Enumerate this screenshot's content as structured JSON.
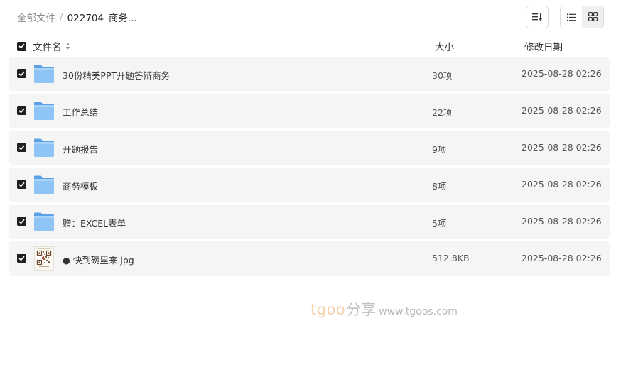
{
  "breadcrumb": {
    "root": "全部文件",
    "separator": "/",
    "current": "022704_商务..."
  },
  "header": {
    "name": "文件名",
    "size": "大小",
    "date": "修改日期"
  },
  "toolbar": {
    "sort_icon": "sort-icon",
    "list_view_icon": "list-view-icon",
    "grid_view_icon": "grid-view-icon",
    "active_view": "grid"
  },
  "files": [
    {
      "name": "30份精美PPT开题答辩商务",
      "size": "30项",
      "date": "2025-08-28 02:26",
      "type": "folder",
      "checked": true
    },
    {
      "name": "工作总结",
      "size": "22项",
      "date": "2025-08-28 02:26",
      "type": "folder",
      "checked": true
    },
    {
      "name": "开题报告",
      "size": "9项",
      "date": "2025-08-28 02:26",
      "type": "folder",
      "checked": true
    },
    {
      "name": "商务模板",
      "size": "8项",
      "date": "2025-08-28 02:26",
      "type": "folder",
      "checked": true
    },
    {
      "name": "赠：EXCEL表单",
      "size": "5项",
      "date": "2025-08-28 02:26",
      "type": "folder",
      "checked": true
    },
    {
      "name": "● 快到碗里来.jpg",
      "size": "512.8KB",
      "date": "2025-08-28 02:26",
      "type": "image",
      "checked": true
    }
  ],
  "watermark": {
    "brand": "tgoo",
    "cn": "分享",
    "url": "www.tgoos.com"
  },
  "colors": {
    "row_bg": "#f5f5f5",
    "checkbox": "#1f1f1f",
    "folder": "#7cb8ef"
  }
}
